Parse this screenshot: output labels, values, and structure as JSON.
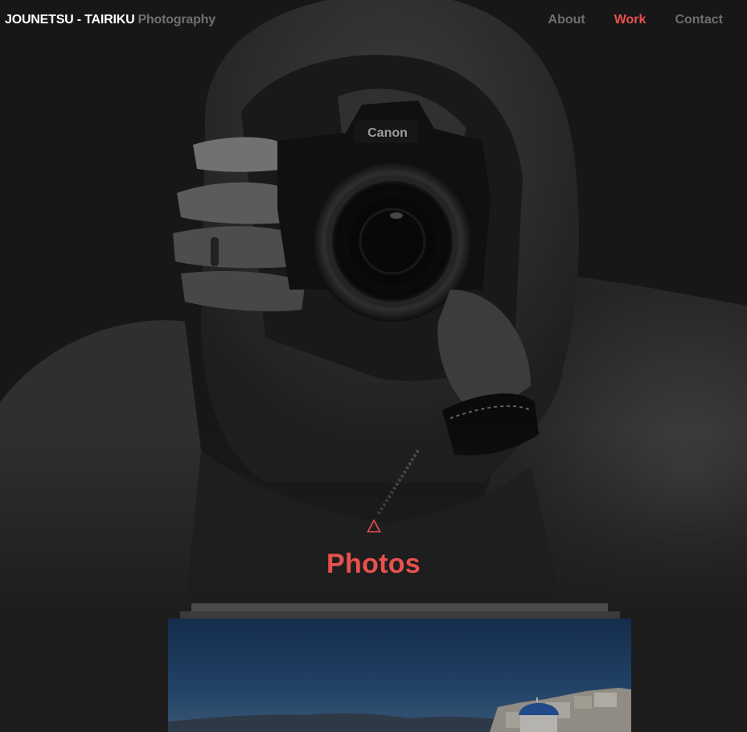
{
  "header": {
    "brand_main": "JOUNETSU - TAIRIKU",
    "brand_sub": "Photography",
    "nav": [
      {
        "label": "About",
        "active": false
      },
      {
        "label": "Work",
        "active": true
      },
      {
        "label": "Contact",
        "active": false
      }
    ]
  },
  "section": {
    "icon": "triangle-outline-icon",
    "title": "Photos"
  },
  "colors": {
    "accent": "#e8514e",
    "background": "#1d1d1d",
    "nav_inactive": "#6e6e6e"
  }
}
